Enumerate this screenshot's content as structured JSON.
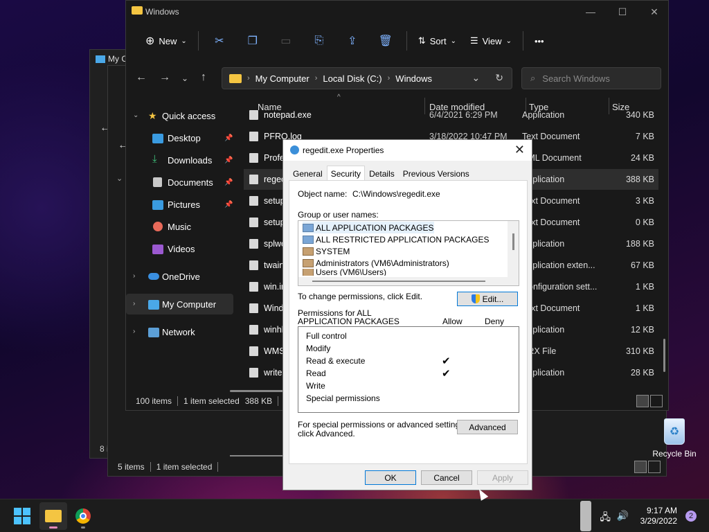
{
  "back_window_1": {
    "title": "My C",
    "status": "8 i"
  },
  "back_window_2": {
    "status_items": "5 items",
    "status_selected": "1 item selected"
  },
  "explorer": {
    "title": "Windows",
    "toolbar": {
      "new_label": "New",
      "sort_label": "Sort",
      "view_label": "View",
      "more_label": "•••"
    },
    "address": {
      "crumbs": [
        "My Computer",
        "Local Disk (C:)",
        "Windows"
      ]
    },
    "search": {
      "placeholder": "Search Windows"
    },
    "nav": {
      "quick_access": "Quick access",
      "desktop": "Desktop",
      "downloads": "Downloads",
      "documents": "Documents",
      "pictures": "Pictures",
      "music": "Music",
      "videos": "Videos",
      "onedrive": "OneDrive",
      "my_computer": "My Computer",
      "network": "Network"
    },
    "columns": {
      "name": "Name",
      "date": "Date modified",
      "type": "Type",
      "size": "Size"
    },
    "files": [
      {
        "name": "notepad.exe",
        "date": "6/4/2021 6:29 PM",
        "type": "Application",
        "size": "340 KB"
      },
      {
        "name": "PFRO.log",
        "date": "3/18/2022 10:47 PM",
        "type": "Text Document",
        "size": "7 KB"
      },
      {
        "name": "Profe",
        "date": "",
        "type": "XML Document",
        "size": "24 KB"
      },
      {
        "name": "regec",
        "date": "",
        "type": "Application",
        "size": "388 KB"
      },
      {
        "name": "setup",
        "date": "",
        "type": "Text Document",
        "size": "3 KB"
      },
      {
        "name": "setup",
        "date": "",
        "type": "Text Document",
        "size": "0 KB"
      },
      {
        "name": "splwo",
        "date": "",
        "type": "Application",
        "size": "188 KB"
      },
      {
        "name": "twain",
        "date": "",
        "type": "Application exten...",
        "size": "67 KB"
      },
      {
        "name": "win.ir",
        "date": "",
        "type": "Configuration sett...",
        "size": "1 KB"
      },
      {
        "name": "Wind",
        "date": "",
        "type": "Text Document",
        "size": "1 KB"
      },
      {
        "name": "winhl",
        "date": "",
        "type": "Application",
        "size": "12 KB"
      },
      {
        "name": "WMS",
        "date": "",
        "type": "PRX File",
        "size": "310 KB"
      },
      {
        "name": "write.",
        "date": "",
        "type": "Application",
        "size": "28 KB"
      }
    ],
    "status": {
      "items": "100 items",
      "selected": "1 item selected",
      "selected_size": "388 KB"
    }
  },
  "dialog": {
    "title": "regedit.exe Properties",
    "tabs": [
      "General",
      "Security",
      "Details",
      "Previous Versions"
    ],
    "object_label": "Object name:",
    "object_value": "C:\\Windows\\regedit.exe",
    "group_label": "Group or user names:",
    "users": [
      "ALL APPLICATION PACKAGES",
      "ALL RESTRICTED APPLICATION PACKAGES",
      "SYSTEM",
      "Administrators (VM6\\Administrators)",
      "Users (VM6\\Users)"
    ],
    "change_text": "To change permissions, click Edit.",
    "edit_button": "Edit...",
    "perm_for_line1": "Permissions for ALL",
    "perm_for_line2": "APPLICATION PACKAGES",
    "allow_label": "Allow",
    "deny_label": "Deny",
    "permissions": [
      {
        "name": "Full control",
        "allow": false
      },
      {
        "name": "Modify",
        "allow": false
      },
      {
        "name": "Read & execute",
        "allow": true
      },
      {
        "name": "Read",
        "allow": true
      },
      {
        "name": "Write",
        "allow": false
      },
      {
        "name": "Special permissions",
        "allow": false
      }
    ],
    "check_glyph": "✔",
    "special_line1": "For special permissions or advanced settings,",
    "special_line2": "click Advanced.",
    "advanced_button": "Advanced",
    "ok_button": "OK",
    "cancel_button": "Cancel",
    "apply_button": "Apply"
  },
  "desktop": {
    "recycle_bin": "Recycle Bin"
  },
  "taskbar": {
    "time": "9:17 AM",
    "date": "3/29/2022",
    "notification_count": "2"
  },
  "colors": {
    "accent": "#4cc2ff",
    "folder": "#f4c542",
    "dialog_bg": "#f0f0f0"
  }
}
